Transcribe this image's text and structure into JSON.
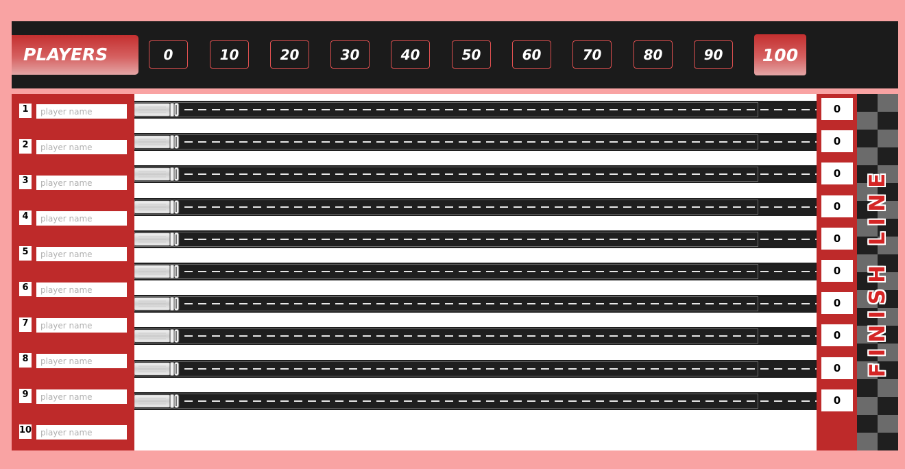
{
  "header": {
    "players_label": "PLAYERS",
    "score_buttons": [
      "0",
      "10",
      "20",
      "30",
      "40",
      "50",
      "60",
      "70",
      "80",
      "90",
      "100"
    ]
  },
  "players": [
    {
      "number": "1",
      "placeholder": "player name",
      "score": "0",
      "progress": 0
    },
    {
      "number": "2",
      "placeholder": "player name",
      "score": "0",
      "progress": 0
    },
    {
      "number": "3",
      "placeholder": "player name",
      "score": "0",
      "progress": 0
    },
    {
      "number": "4",
      "placeholder": "player name",
      "score": "0",
      "progress": 0
    },
    {
      "number": "5",
      "placeholder": "player name",
      "score": "0",
      "progress": 0
    },
    {
      "number": "6",
      "placeholder": "player name",
      "score": "0",
      "progress": 0
    },
    {
      "number": "7",
      "placeholder": "player name",
      "score": "0",
      "progress": 0
    },
    {
      "number": "8",
      "placeholder": "player name",
      "score": "0",
      "progress": 0
    },
    {
      "number": "9",
      "placeholder": "player name",
      "score": "0",
      "progress": 0
    },
    {
      "number": "10",
      "placeholder": "player name",
      "score": "0",
      "progress": 0
    }
  ],
  "finish_label": "FINISH LINE",
  "icons": {
    "car": "race-car-icon"
  },
  "colors": {
    "background": "#f9a3a3",
    "bar": "#1b1b1b",
    "panel": "#be2a2a",
    "accent": "#d42424",
    "checker_dark": "#1f1f1f",
    "checker_light": "#6b6b6b"
  }
}
